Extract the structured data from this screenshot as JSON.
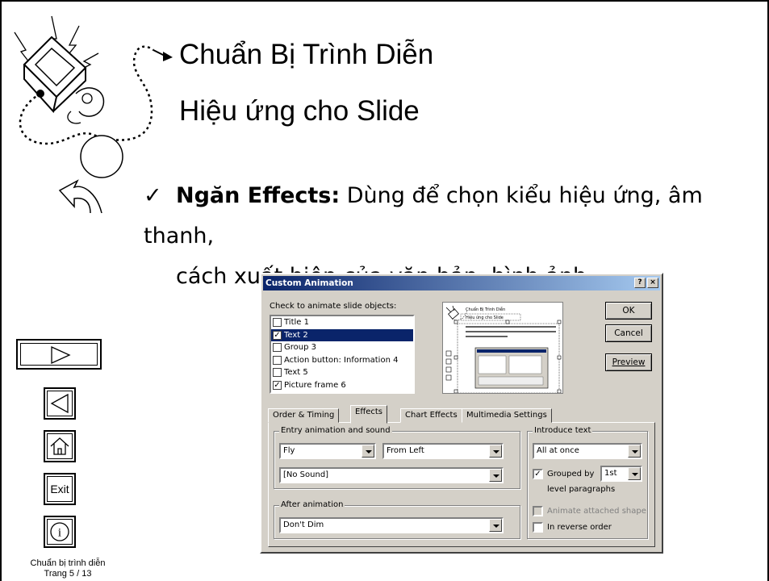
{
  "slide": {
    "title1": "Chuẩn Bị Trình Diễn",
    "title2": "Hiệu ứng cho Slide",
    "bullet_check": "✓",
    "bullet_bold": "Ngăn Effects:",
    "bullet_text": " Dùng để chọn kiểu hiệu ứng, âm thanh,",
    "bullet_line2": "cách xuất hiện của văn bản, hình ảnh.",
    "footer_line1": "Chuẩn bị trình diễn",
    "footer_line2": "Trang 5 / 13"
  },
  "nav": {
    "next_icon": "play-right-icon",
    "prev_icon": "play-left-icon",
    "home_icon": "home-icon",
    "exit_label": "Exit",
    "info_icon": "info-icon"
  },
  "dialog": {
    "title": "Custom Animation",
    "help_btn": "?",
    "close_btn": "×",
    "check_label": "Check to animate slide objects:",
    "objects": [
      {
        "label": "Title 1",
        "checked": false,
        "selected": false
      },
      {
        "label": "Text 2",
        "checked": true,
        "selected": true
      },
      {
        "label": "Group 3",
        "checked": false,
        "selected": false
      },
      {
        "label": "Action button: Information 4",
        "checked": false,
        "selected": false
      },
      {
        "label": "Text 5",
        "checked": false,
        "selected": false
      },
      {
        "label": "Picture frame 6",
        "checked": true,
        "selected": false
      }
    ],
    "preview_title1": "Chuẩn Bị Trình Diễn",
    "preview_title2": "Hiệu ứng cho Slide",
    "ok": "OK",
    "cancel": "Cancel",
    "preview_btn": "Preview",
    "tabs": [
      "Order & Timing",
      "Effects",
      "Chart Effects",
      "Multimedia Settings"
    ],
    "active_tab": "Effects",
    "entry_group": "Entry animation and sound",
    "entry_effect": "Fly",
    "entry_direction": "From Left",
    "sound": "[No Sound]",
    "after_group": "After animation",
    "after_value": "Don't Dim",
    "intro_group": "Introduce text",
    "intro_value": "All at once",
    "grouped_label": "Grouped by",
    "grouped_value": "1st",
    "level_label": "level paragraphs",
    "animate_shape": "Animate attached shape",
    "reverse": "In reverse order"
  }
}
